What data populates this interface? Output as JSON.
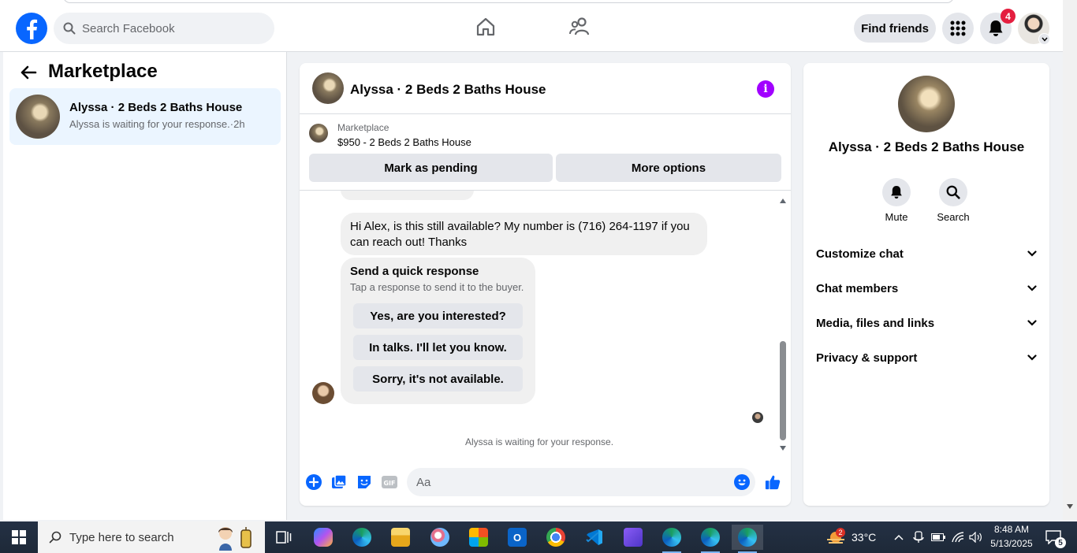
{
  "header": {
    "search_placeholder": "Search Facebook",
    "find_friends_label": "Find friends",
    "notification_count": "4",
    "icons": [
      "facebook-logo-icon",
      "search-icon",
      "home-icon",
      "friends-icon",
      "menu-grid-icon",
      "bell-icon"
    ],
    "brand_color": "#0866ff"
  },
  "left_panel": {
    "title": "Marketplace",
    "conversations": [
      {
        "name": "Alyssa · 2 Beds 2 Baths House",
        "preview": "Alyssa is waiting for your response.·2h"
      }
    ]
  },
  "chat": {
    "title": "Alyssa · 2 Beds 2 Baths House",
    "listing_label": "Marketplace",
    "listing_price_title": "$950 - 2 Beds 2 Baths House",
    "mark_pending_label": "Mark as pending",
    "more_options_label": "More options",
    "message_text": "Hi Alex, is this still available? My number is (716) 264-1197 if you can reach out! Thanks",
    "quick_response": {
      "title": "Send a quick response",
      "subtitle": "Tap a response to send it to the buyer.",
      "options": [
        "Yes, are you interested?",
        "In talks. I'll let you know.",
        "Sorry, it's not available."
      ]
    },
    "waiting_text": "Alyssa is waiting for your response.",
    "input_placeholder": "Aa",
    "accent_color": "#0866ff",
    "info_color": "#a100ff"
  },
  "right_panel": {
    "name": "Alyssa · 2 Beds 2 Baths House",
    "actions": [
      {
        "label": "Mute",
        "icon": "bell-icon"
      },
      {
        "label": "Search",
        "icon": "search-icon"
      }
    ],
    "sections": [
      "Customize chat",
      "Chat members",
      "Media, files and links",
      "Privacy & support"
    ]
  },
  "taskbar": {
    "search_placeholder": "Type here to search",
    "weather_temp": "33°C",
    "weather_badge": "2",
    "time": "8:48 AM",
    "date": "5/13/2025",
    "notification_count": "5"
  }
}
